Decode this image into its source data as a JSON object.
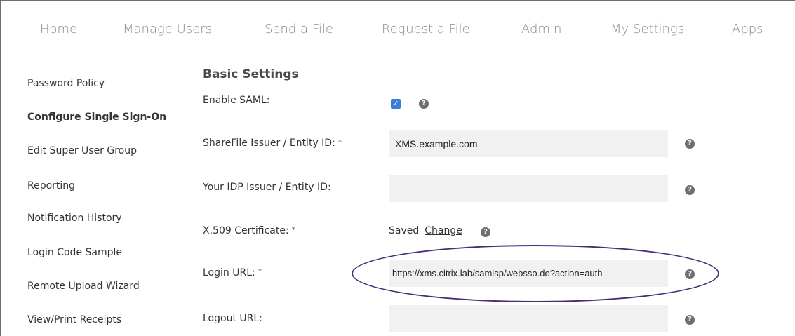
{
  "nav": {
    "items": [
      {
        "label": "Home"
      },
      {
        "label": "Manage Users"
      },
      {
        "label": "Send a File"
      },
      {
        "label": "Request a File"
      },
      {
        "label": "Admin"
      },
      {
        "label": "My Settings"
      },
      {
        "label": "Apps"
      }
    ]
  },
  "sidebar": {
    "items": [
      {
        "label": "Password Policy"
      },
      {
        "label": "Configure Single Sign-On",
        "active": true
      },
      {
        "label": "Edit Super User Group"
      },
      {
        "label": "Reporting"
      },
      {
        "label": "Notification History"
      },
      {
        "label": "Login Code Sample"
      },
      {
        "label": "Remote Upload Wizard"
      },
      {
        "label": "View/Print Receipts"
      }
    ]
  },
  "main": {
    "section_title": "Basic Settings",
    "required_marker": "*",
    "help_glyph": "?",
    "checkbox_glyph": "✓",
    "enable_saml": {
      "label": "Enable SAML:",
      "checked": true
    },
    "issuer": {
      "label": "ShareFile Issuer / Entity ID:",
      "value": "XMS.example.com",
      "required": true
    },
    "idp_issuer": {
      "label": "Your IDP Issuer / Entity ID:",
      "value": ""
    },
    "certificate": {
      "label": "X.509 Certificate:",
      "status": "Saved",
      "change_link": "Change",
      "required": true
    },
    "login_url": {
      "label": "Login URL:",
      "value": "https://xms.citrix.lab/samlsp/websso.do?action=auth",
      "required": true
    },
    "logout_url": {
      "label": "Logout URL:",
      "value": ""
    }
  },
  "colors": {
    "accent_checkbox": "#3a7fd6",
    "required_marker": "#7b3f9e",
    "annotation_ellipse": "#4b2a7a",
    "field_bg": "#f1f1f1"
  }
}
